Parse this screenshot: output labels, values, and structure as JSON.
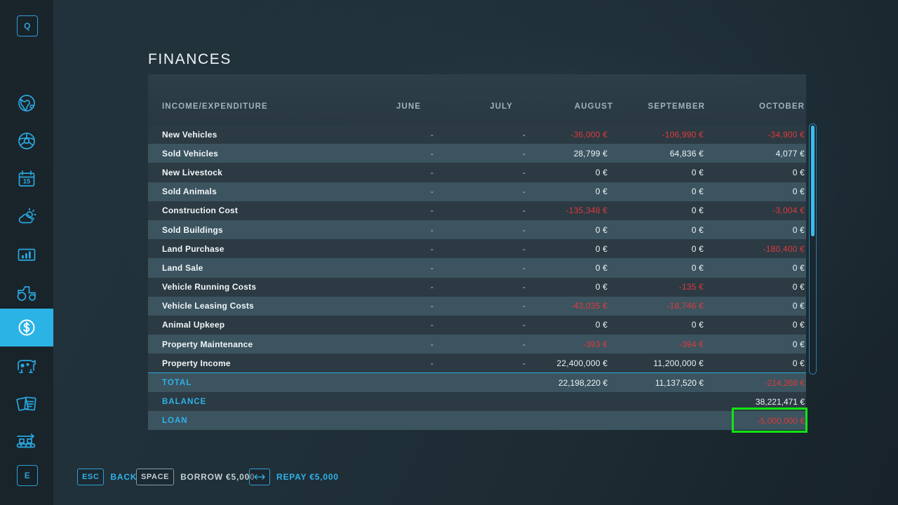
{
  "window": {
    "title": "FINANCES"
  },
  "colors": {
    "accent": "#2fb2e8",
    "negative": "#e0393b",
    "highlight_border": "#13e313",
    "row_odd": "#2b3a43",
    "row_even": "#3b5460",
    "background": "#1f2d35"
  },
  "sidebar": {
    "top_key": "Q",
    "bottom_key": "E",
    "items": [
      {
        "icon": "globe-map-icon",
        "name": "map",
        "active": false
      },
      {
        "icon": "steering-wheel-icon",
        "name": "vehicles",
        "active": false
      },
      {
        "icon": "calendar-icon",
        "name": "calendar",
        "active": false,
        "day": "15"
      },
      {
        "icon": "weather-sun-cloud-icon",
        "name": "weather",
        "active": false
      },
      {
        "icon": "statistics-bar-chart-icon",
        "name": "statistics",
        "active": false
      },
      {
        "icon": "tractor-icon",
        "name": "machinery",
        "active": false
      },
      {
        "icon": "dollar-coin-icon",
        "name": "finances",
        "active": true
      },
      {
        "icon": "cow-icon",
        "name": "animals",
        "active": false
      },
      {
        "icon": "contracts-papers-icon",
        "name": "contracts",
        "active": false
      },
      {
        "icon": "production-conveyor-icon",
        "name": "production",
        "active": false
      }
    ]
  },
  "table": {
    "columns": [
      "INCOME/EXPENDITURE",
      "JUNE",
      "JULY",
      "AUGUST",
      "SEPTEMBER",
      "OCTOBER"
    ],
    "rows": [
      {
        "label": "New Vehicles",
        "values": [
          "-",
          "-",
          "-36,000 €",
          "-106,990 €",
          "-34,900 €"
        ]
      },
      {
        "label": "Sold Vehicles",
        "values": [
          "-",
          "-",
          "28,799 €",
          "64,836 €",
          "4,077 €"
        ]
      },
      {
        "label": "New Livestock",
        "values": [
          "-",
          "-",
          "0 €",
          "0 €",
          "0 €"
        ]
      },
      {
        "label": "Sold Animals",
        "values": [
          "-",
          "-",
          "0 €",
          "0 €",
          "0 €"
        ]
      },
      {
        "label": "Construction Cost",
        "values": [
          "-",
          "-",
          "-135,348 €",
          "0 €",
          "-3,004 €"
        ]
      },
      {
        "label": "Sold Buildings",
        "values": [
          "-",
          "-",
          "0 €",
          "0 €",
          "0 €"
        ]
      },
      {
        "label": "Land Purchase",
        "values": [
          "-",
          "-",
          "0 €",
          "0 €",
          "-180,400 €"
        ]
      },
      {
        "label": "Land Sale",
        "values": [
          "-",
          "-",
          "0 €",
          "0 €",
          "0 €"
        ]
      },
      {
        "label": "Vehicle Running Costs",
        "values": [
          "-",
          "-",
          "0 €",
          "-135 €",
          "0 €"
        ]
      },
      {
        "label": "Vehicle Leasing Costs",
        "values": [
          "-",
          "-",
          "-43,035 €",
          "-18,746 €",
          "0 €"
        ]
      },
      {
        "label": "Animal Upkeep",
        "values": [
          "-",
          "-",
          "0 €",
          "0 €",
          "0 €"
        ]
      },
      {
        "label": "Property Maintenance",
        "values": [
          "-",
          "-",
          "-393 €",
          "-394 €",
          "0 €"
        ]
      },
      {
        "label": "Property Income",
        "values": [
          "-",
          "-",
          "22,400,000 €",
          "11,200,000 €",
          "0 €"
        ]
      }
    ],
    "summary": [
      {
        "label": "TOTAL",
        "values": [
          "",
          "",
          "22,198,220 €",
          "11,137,520 €",
          "-214,268 €"
        ]
      },
      {
        "label": "BALANCE",
        "values": [
          "",
          "",
          "",
          "",
          "38,221,471 €"
        ]
      },
      {
        "label": "LOAN",
        "values": [
          "",
          "",
          "",
          "",
          "-5,000,000 €"
        ]
      }
    ]
  },
  "bottom_bar": {
    "hints": [
      {
        "key": "ESC",
        "label": "BACK",
        "style": "accent"
      },
      {
        "key": "SPACE",
        "label": "BORROW €5,000",
        "style": "gray"
      },
      {
        "key": "↔",
        "label": "REPAY €5,000",
        "style": "accent"
      }
    ]
  }
}
